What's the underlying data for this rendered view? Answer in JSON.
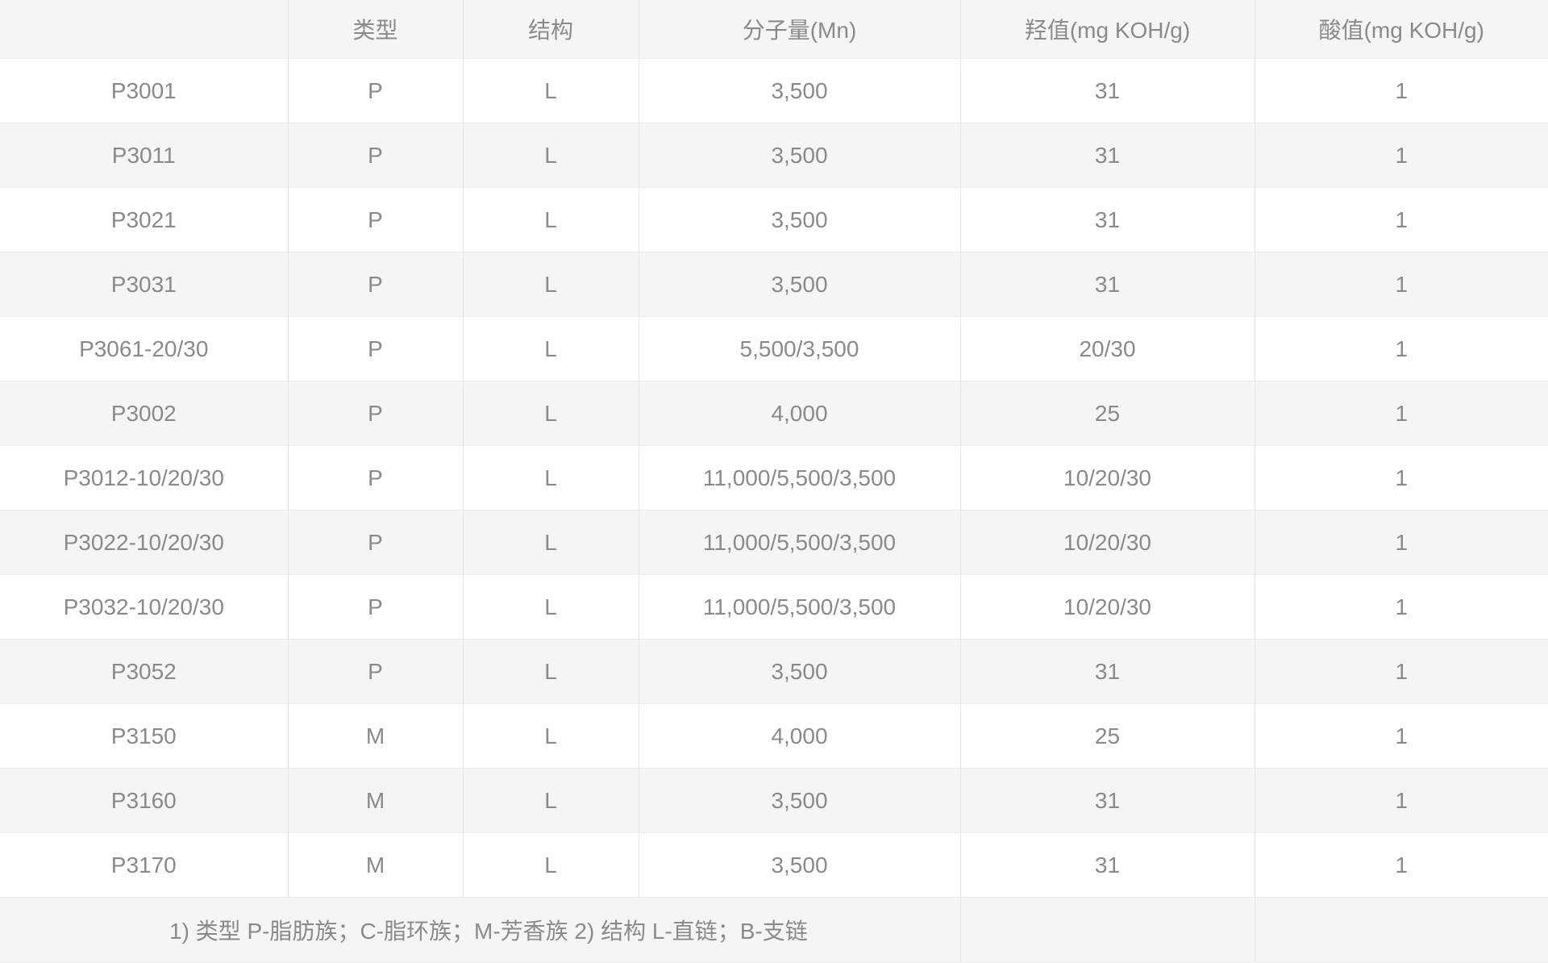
{
  "table": {
    "headers": [
      "",
      "类型",
      "结构",
      "分子量(Mn)",
      "羟值(mg KOH/g)",
      "酸值(mg KOH/g)"
    ],
    "rows": [
      [
        "P3001",
        "P",
        "L",
        "3,500",
        "31",
        "1"
      ],
      [
        "P3011",
        "P",
        "L",
        "3,500",
        "31",
        "1"
      ],
      [
        "P3021",
        "P",
        "L",
        "3,500",
        "31",
        "1"
      ],
      [
        "P3031",
        "P",
        "L",
        "3,500",
        "31",
        "1"
      ],
      [
        "P3061-20/30",
        "P",
        "L",
        "5,500/3,500",
        "20/30",
        "1"
      ],
      [
        "P3002",
        "P",
        "L",
        "4,000",
        "25",
        "1"
      ],
      [
        "P3012-10/20/30",
        "P",
        "L",
        "11,000/5,500/3,500",
        "10/20/30",
        "1"
      ],
      [
        "P3022-10/20/30",
        "P",
        "L",
        "11,000/5,500/3,500",
        "10/20/30",
        "1"
      ],
      [
        "P3032-10/20/30",
        "P",
        "L",
        "11,000/5,500/3,500",
        "10/20/30",
        "1"
      ],
      [
        "P3052",
        "P",
        "L",
        "3,500",
        "31",
        "1"
      ],
      [
        "P3150",
        "M",
        "L",
        "4,000",
        "25",
        "1"
      ],
      [
        "P3160",
        "M",
        "L",
        "3,500",
        "31",
        "1"
      ],
      [
        "P3170",
        "M",
        "L",
        "3,500",
        "31",
        "1"
      ]
    ],
    "note": "1) 类型 P-脂肪族；C-脂环族；M-芳香族 2) 结构 L-直链；B-支链"
  }
}
